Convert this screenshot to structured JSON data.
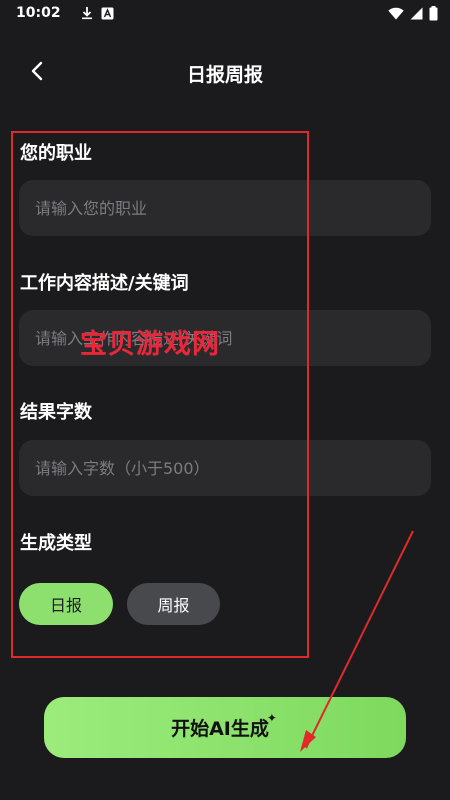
{
  "status_bar": {
    "time": "10:02",
    "icons_left": [
      "download-icon",
      "font-icon"
    ],
    "icons_right": [
      "wifi-icon",
      "signal-icon",
      "battery-icon"
    ]
  },
  "header": {
    "title": "日报周报",
    "back_icon": "chevron-left-icon"
  },
  "form": {
    "occupation": {
      "label": "您的职业",
      "placeholder": "请输入您的职业",
      "value": ""
    },
    "description": {
      "label": "工作内容描述/关键词",
      "placeholder": "请输入工作内容描述/关键词",
      "value": ""
    },
    "word_count": {
      "label": "结果字数",
      "placeholder": "请输入字数（小于500）",
      "value": ""
    },
    "type": {
      "label": "生成类型",
      "options": [
        "日报",
        "周报"
      ],
      "selected": "日报"
    }
  },
  "generate_button": {
    "label": "开始AI生成",
    "icon": "sparkle-icon"
  },
  "annotation": {
    "watermark": "宝贝游戏网"
  },
  "colors": {
    "background": "#1b1b1d",
    "field": "#2a2a2d",
    "accent": "#8ee06e",
    "chip_inactive": "#48494d",
    "annotation_red": "#e02a2a"
  }
}
